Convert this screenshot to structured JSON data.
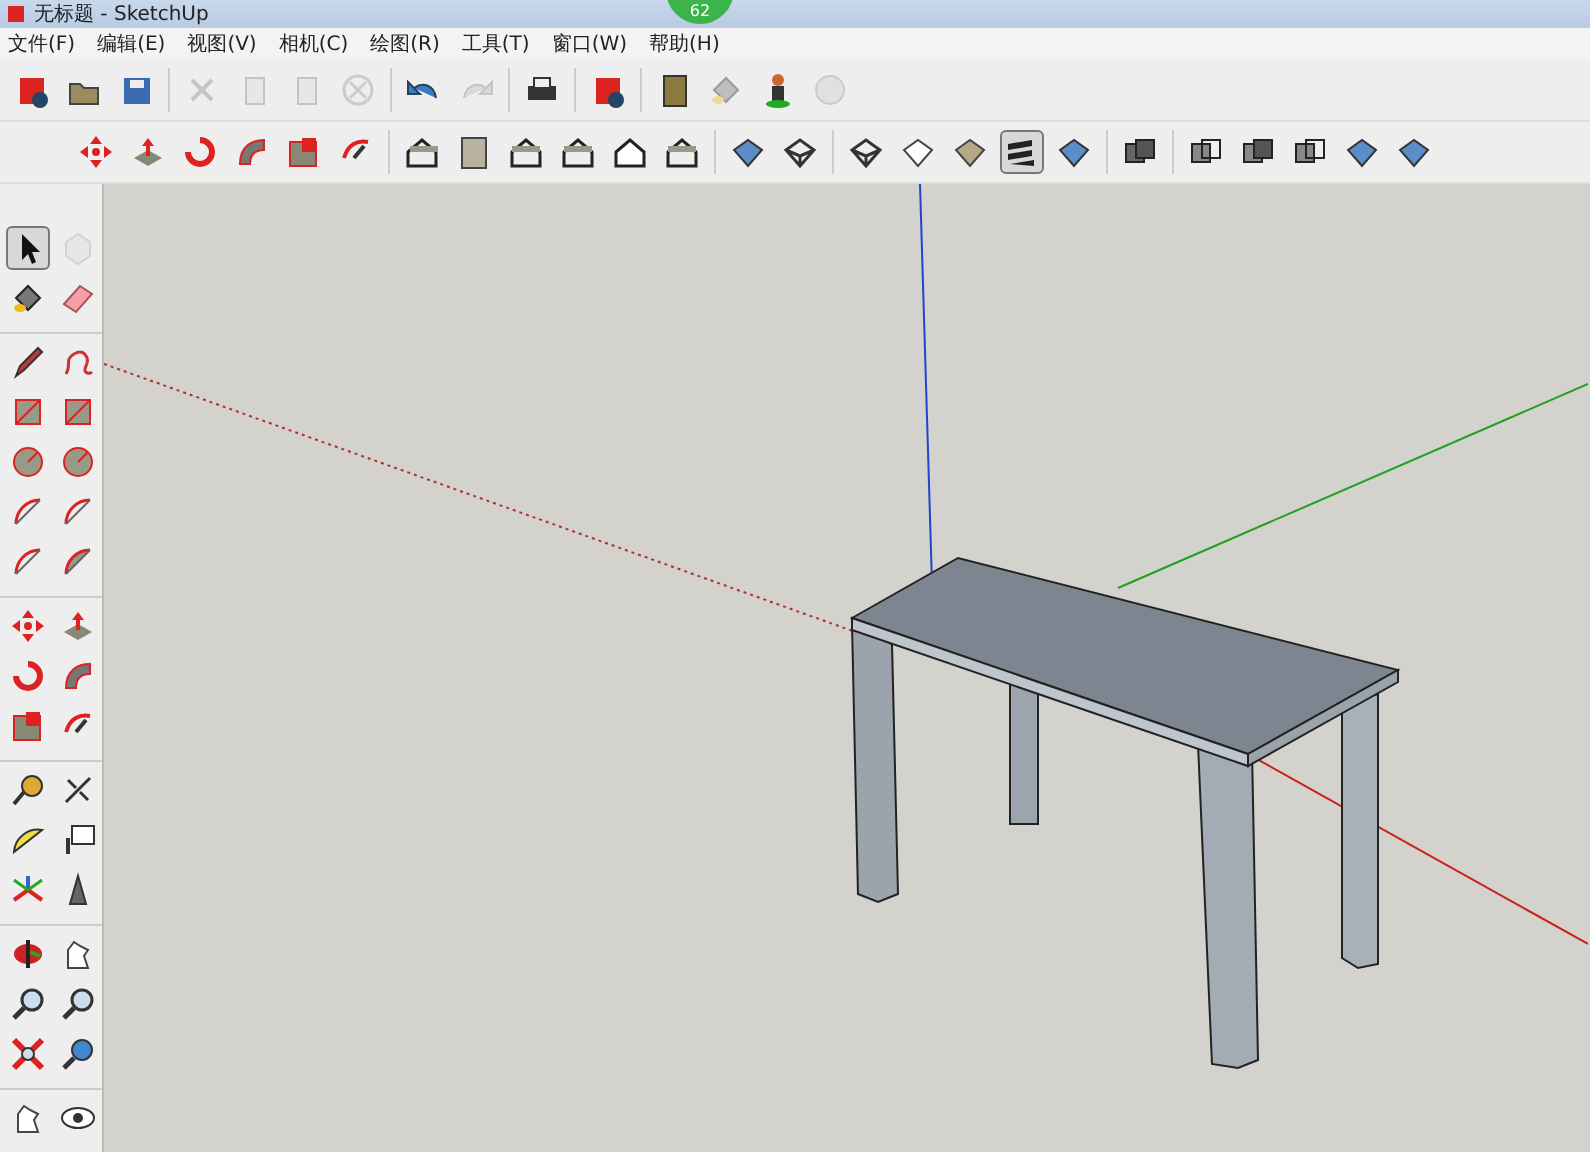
{
  "window": {
    "title": "无标题 - SketchUp",
    "badge": "62"
  },
  "menu": [
    "文件(F)",
    "编辑(E)",
    "视图(V)",
    "相机(C)",
    "绘图(R)",
    "工具(T)",
    "窗口(W)",
    "帮助(H)"
  ],
  "toolbar_top": [
    [
      {
        "kind": "new-file",
        "selected": false,
        "disabled": false
      },
      {
        "kind": "folder",
        "selected": false,
        "disabled": false
      },
      {
        "kind": "floppy-disk",
        "selected": false,
        "disabled": false
      }
    ],
    [
      {
        "kind": "scissors",
        "selected": false,
        "disabled": true
      },
      {
        "kind": "copy",
        "selected": false,
        "disabled": true
      },
      {
        "kind": "clipboard",
        "selected": false,
        "disabled": true
      },
      {
        "kind": "delete",
        "selected": false,
        "disabled": true
      }
    ],
    [
      {
        "kind": "undo",
        "selected": false,
        "disabled": false
      },
      {
        "kind": "redo",
        "selected": false,
        "disabled": true
      }
    ],
    [
      {
        "kind": "printer",
        "selected": false,
        "disabled": false
      }
    ],
    [
      {
        "kind": "info",
        "selected": false,
        "disabled": false
      }
    ],
    [
      {
        "kind": "book",
        "selected": false,
        "disabled": false
      },
      {
        "kind": "paint-bucket",
        "selected": false,
        "disabled": true
      },
      {
        "kind": "person",
        "selected": false,
        "disabled": false
      },
      {
        "kind": "sphere",
        "selected": false,
        "disabled": true
      }
    ]
  ],
  "toolbar_second": [
    [
      {
        "kind": "move",
        "selected": false,
        "disabled": false
      },
      {
        "kind": "push-pull",
        "selected": false,
        "disabled": false
      },
      {
        "kind": "rotate",
        "selected": false,
        "disabled": false
      },
      {
        "kind": "follow-me",
        "selected": false,
        "disabled": false
      },
      {
        "kind": "scale",
        "selected": false,
        "disabled": false
      },
      {
        "kind": "offset",
        "selected": false,
        "disabled": false
      }
    ],
    [
      {
        "kind": "iso-house",
        "selected": false,
        "disabled": false
      },
      {
        "kind": "box",
        "selected": false,
        "disabled": false
      },
      {
        "kind": "house",
        "selected": false,
        "disabled": false
      },
      {
        "kind": "house",
        "selected": false,
        "disabled": false
      },
      {
        "kind": "house-outline",
        "selected": false,
        "disabled": false
      },
      {
        "kind": "house",
        "selected": false,
        "disabled": false
      }
    ],
    [
      {
        "kind": "xray-cube",
        "selected": false,
        "disabled": false
      },
      {
        "kind": "wire-cube",
        "selected": false,
        "disabled": false
      }
    ],
    [
      {
        "kind": "wire-cube",
        "selected": false,
        "disabled": false
      },
      {
        "kind": "hidden-line-cube",
        "selected": false,
        "disabled": false
      },
      {
        "kind": "shaded-cube",
        "selected": false,
        "disabled": false
      },
      {
        "kind": "striped-cube",
        "selected": true,
        "disabled": false
      },
      {
        "kind": "textured-cube",
        "selected": false,
        "disabled": false
      }
    ],
    [
      {
        "kind": "solid-union",
        "selected": false,
        "disabled": false
      }
    ],
    [
      {
        "kind": "solid-outer",
        "selected": false,
        "disabled": false
      },
      {
        "kind": "solid-intersect",
        "selected": false,
        "disabled": false
      },
      {
        "kind": "solid-outer",
        "selected": false,
        "disabled": false
      },
      {
        "kind": "textured-cube",
        "selected": false,
        "disabled": false
      },
      {
        "kind": "textured-cube",
        "selected": false,
        "disabled": false
      }
    ]
  ],
  "toolbar_left": [
    [
      {
        "kind": "pointer",
        "selected": true,
        "disabled": false
      },
      {
        "kind": "component",
        "selected": false,
        "disabled": true
      },
      {
        "kind": "paint-bucket",
        "selected": false,
        "disabled": false
      },
      {
        "kind": "eraser",
        "selected": false,
        "disabled": false
      }
    ],
    [
      {
        "kind": "pencil",
        "selected": false,
        "disabled": false
      },
      {
        "kind": "freehand",
        "selected": false,
        "disabled": false
      },
      {
        "kind": "rectangle",
        "selected": false,
        "disabled": false
      },
      {
        "kind": "rotated-rectangle",
        "selected": false,
        "disabled": false
      },
      {
        "kind": "circle",
        "selected": false,
        "disabled": false
      },
      {
        "kind": "polygon",
        "selected": false,
        "disabled": false
      },
      {
        "kind": "arc",
        "selected": false,
        "disabled": false
      },
      {
        "kind": "arc",
        "selected": false,
        "disabled": false
      },
      {
        "kind": "arc",
        "selected": false,
        "disabled": false
      },
      {
        "kind": "pie",
        "selected": false,
        "disabled": false
      }
    ],
    [
      {
        "kind": "move",
        "selected": false,
        "disabled": false
      },
      {
        "kind": "push-pull",
        "selected": false,
        "disabled": false
      },
      {
        "kind": "rotate",
        "selected": false,
        "disabled": false
      },
      {
        "kind": "follow-me",
        "selected": false,
        "disabled": false
      },
      {
        "kind": "scale",
        "selected": false,
        "disabled": false
      },
      {
        "kind": "offset",
        "selected": false,
        "disabled": false
      }
    ],
    [
      {
        "kind": "tape-measure",
        "selected": false,
        "disabled": false
      },
      {
        "kind": "dimension",
        "selected": false,
        "disabled": false
      },
      {
        "kind": "protractor",
        "selected": false,
        "disabled": false
      },
      {
        "kind": "text-label",
        "selected": false,
        "disabled": false
      },
      {
        "kind": "axes",
        "selected": false,
        "disabled": false
      },
      {
        "kind": "text-3d",
        "selected": false,
        "disabled": false
      }
    ],
    [
      {
        "kind": "orbit",
        "selected": false,
        "disabled": false
      },
      {
        "kind": "pan",
        "selected": false,
        "disabled": false
      },
      {
        "kind": "zoom",
        "selected": false,
        "disabled": false
      },
      {
        "kind": "zoom-window",
        "selected": false,
        "disabled": false
      },
      {
        "kind": "zoom-extents",
        "selected": false,
        "disabled": false
      },
      {
        "kind": "previous-view",
        "selected": false,
        "disabled": false
      }
    ],
    [
      {
        "kind": "walk",
        "selected": false,
        "disabled": false
      },
      {
        "kind": "eye",
        "selected": false,
        "disabled": false
      }
    ]
  ]
}
